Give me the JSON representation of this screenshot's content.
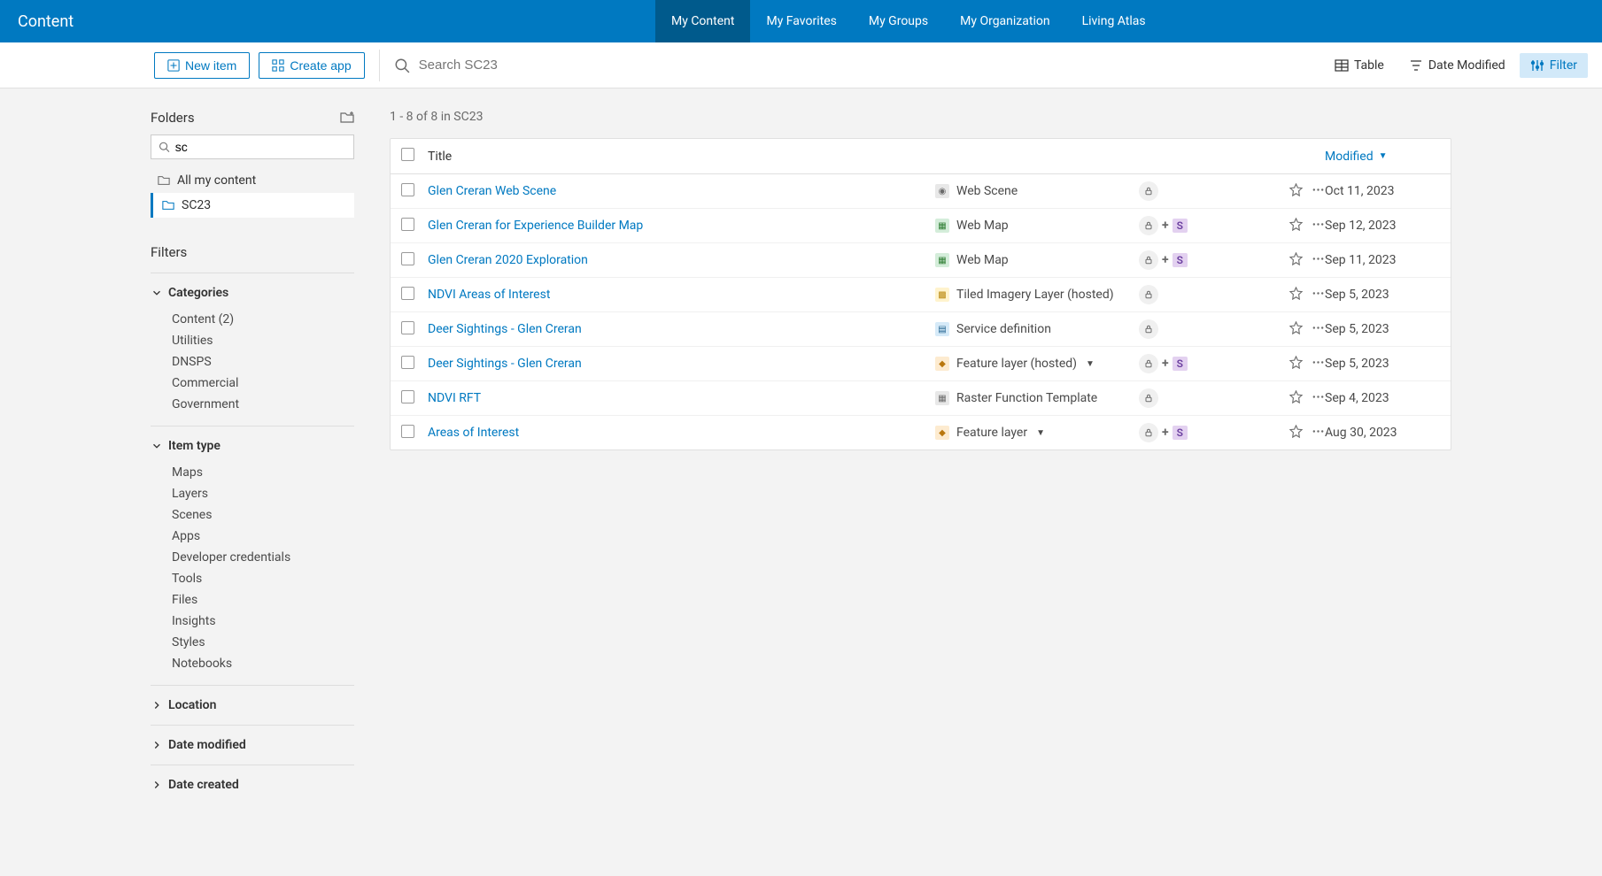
{
  "header": {
    "title": "Content",
    "tabs": [
      {
        "label": "My Content",
        "active": true
      },
      {
        "label": "My Favorites",
        "active": false
      },
      {
        "label": "My Groups",
        "active": false
      },
      {
        "label": "My Organization",
        "active": false
      },
      {
        "label": "Living Atlas",
        "active": false
      }
    ]
  },
  "toolbar": {
    "new_item": "New item",
    "create_app": "Create app",
    "search_placeholder": "Search SC23",
    "view_table": "Table",
    "sort_label": "Date Modified",
    "filter_label": "Filter"
  },
  "sidebar": {
    "folders_title": "Folders",
    "folder_search_value": "sc",
    "all_content": "All my content",
    "active_folder": "SC23",
    "filters_title": "Filters",
    "groups": [
      {
        "name": "Categories",
        "expanded": true,
        "items": [
          "Content  (2)",
          "Utilities",
          "DNSPS",
          "Commercial",
          "Government"
        ]
      },
      {
        "name": "Item type",
        "expanded": true,
        "items": [
          "Maps",
          "Layers",
          "Scenes",
          "Apps",
          "Developer credentials",
          "Tools",
          "Files",
          "Insights",
          "Styles",
          "Notebooks"
        ]
      },
      {
        "name": "Location",
        "expanded": false,
        "items": []
      },
      {
        "name": "Date modified",
        "expanded": false,
        "items": []
      },
      {
        "name": "Date created",
        "expanded": false,
        "items": []
      }
    ]
  },
  "content": {
    "results_text": "1 - 8 of 8 in SC23",
    "columns": {
      "title": "Title",
      "modified": "Modified"
    },
    "rows": [
      {
        "title": "Glen Creran Web Scene",
        "type": "Web Scene",
        "type_icon": "globe",
        "plus": false,
        "s": false,
        "dd": false,
        "modified": "Oct 11, 2023"
      },
      {
        "title": "Glen Creran for Experience Builder Map",
        "type": "Web Map",
        "type_icon": "map",
        "plus": true,
        "s": true,
        "dd": false,
        "modified": "Sep 12, 2023"
      },
      {
        "title": "Glen Creran 2020 Exploration",
        "type": "Web Map",
        "type_icon": "map",
        "plus": true,
        "s": true,
        "dd": false,
        "modified": "Sep 11, 2023"
      },
      {
        "title": "NDVI Areas of Interest",
        "type": "Tiled Imagery Layer (hosted)",
        "type_icon": "imagery",
        "plus": false,
        "s": false,
        "dd": false,
        "modified": "Sep 5, 2023"
      },
      {
        "title": "Deer Sightings - Glen Creran",
        "type": "Service definition",
        "type_icon": "servicedef",
        "plus": false,
        "s": false,
        "dd": false,
        "modified": "Sep 5, 2023"
      },
      {
        "title": "Deer Sightings - Glen Creran",
        "type": "Feature layer (hosted)",
        "type_icon": "feature",
        "plus": true,
        "s": true,
        "dd": true,
        "modified": "Sep 5, 2023"
      },
      {
        "title": "NDVI RFT",
        "type": "Raster Function Template",
        "type_icon": "raster",
        "plus": false,
        "s": false,
        "dd": false,
        "modified": "Sep 4, 2023"
      },
      {
        "title": "Areas of Interest",
        "type": "Feature layer",
        "type_icon": "feature",
        "plus": true,
        "s": true,
        "dd": true,
        "modified": "Aug 30, 2023"
      }
    ]
  },
  "badges": {
    "s": "S",
    "plus": "+"
  },
  "icons": {
    "type_colors": {
      "globe": {
        "bg": "#e8e8e8",
        "fg": "#6a6a6a",
        "char": "◉"
      },
      "map": {
        "bg": "#d4edda",
        "fg": "#2e7d32",
        "char": "▦"
      },
      "imagery": {
        "bg": "#fff3cd",
        "fg": "#b8860b",
        "char": "▩"
      },
      "servicedef": {
        "bg": "#d6eaf8",
        "fg": "#1f618d",
        "char": "▤"
      },
      "feature": {
        "bg": "#fdebd0",
        "fg": "#b9770e",
        "char": "◆"
      },
      "raster": {
        "bg": "#e8e8e8",
        "fg": "#6a6a6a",
        "char": "▦"
      }
    }
  }
}
